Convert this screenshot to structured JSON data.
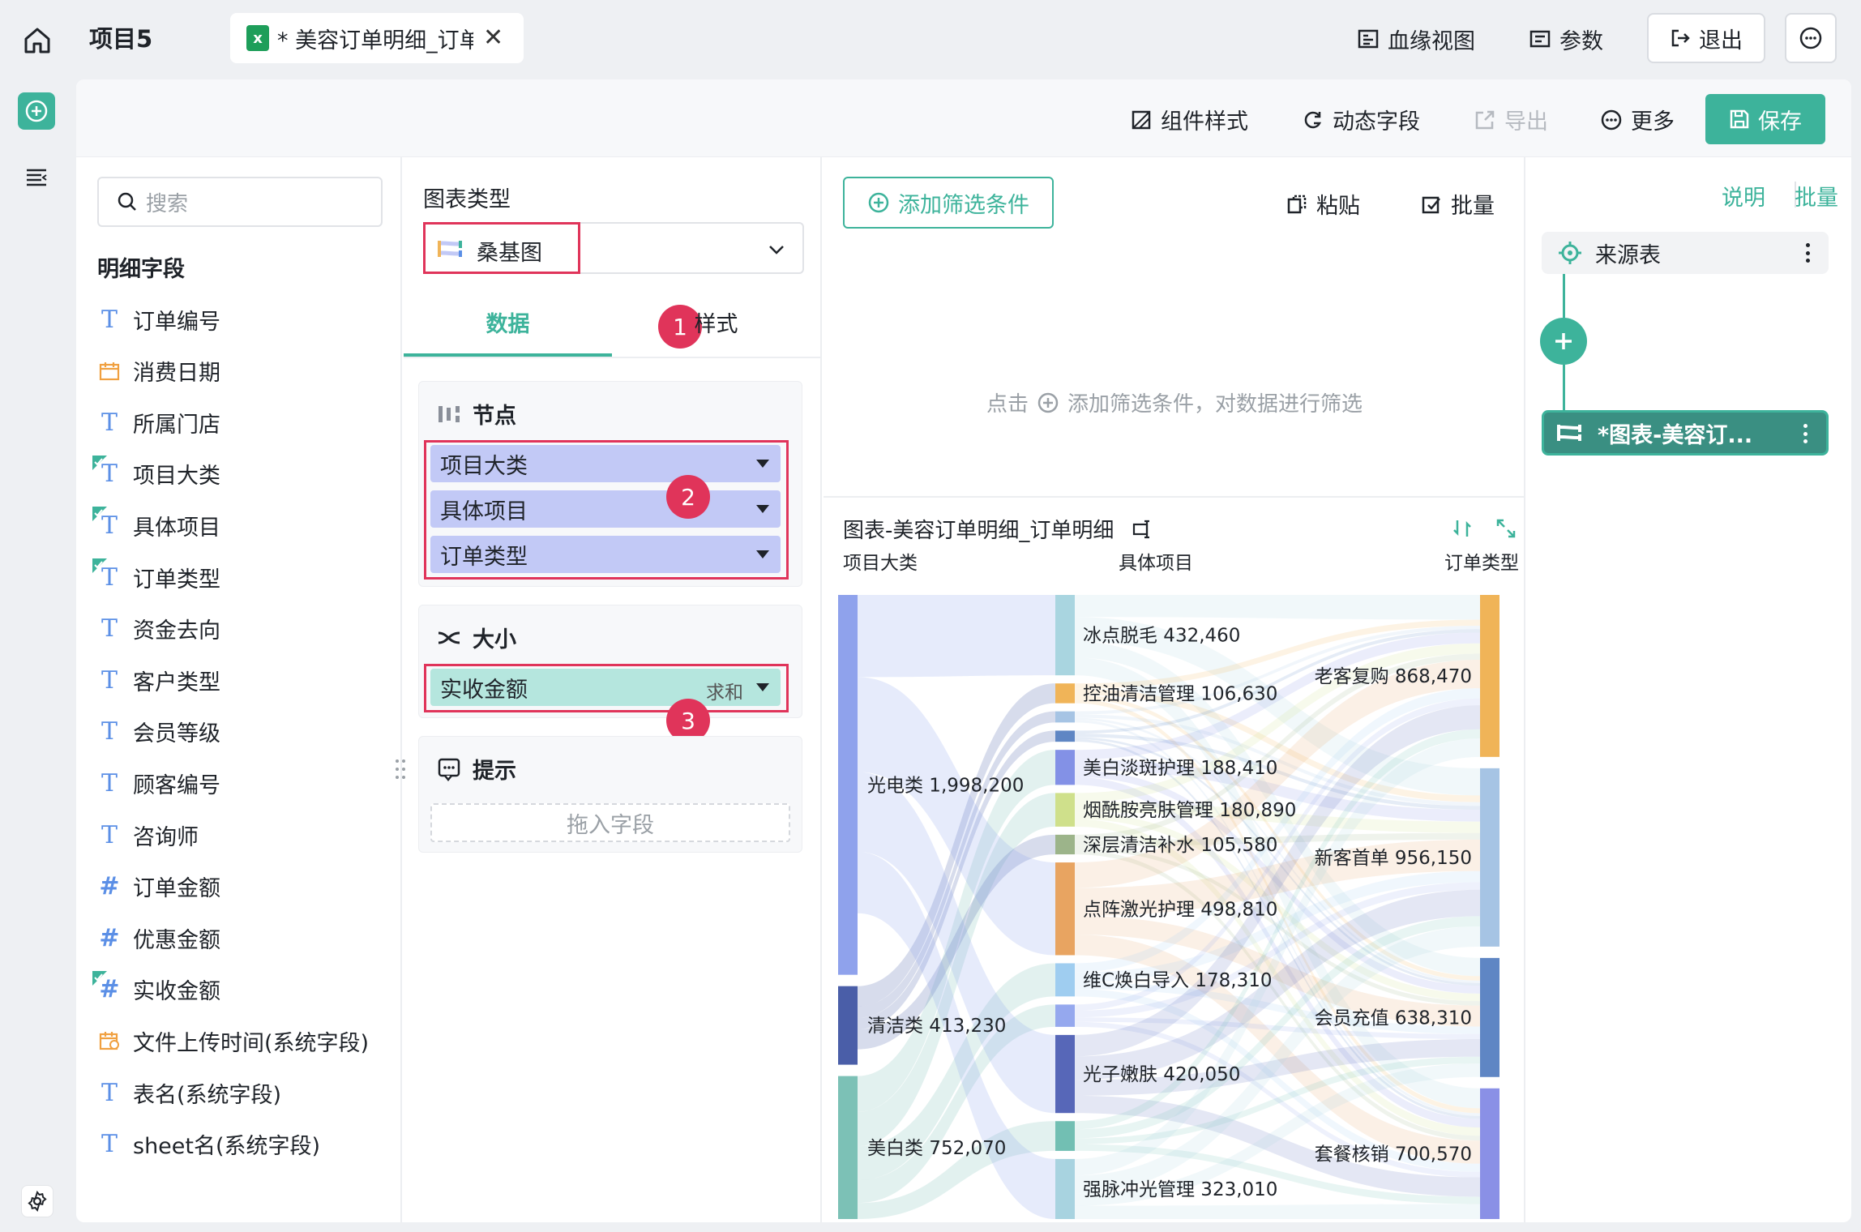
{
  "topbar": {
    "project_title": "项目5",
    "tab_label": "* 美容订单明细_订单明细",
    "lineage_label": "血缘视图",
    "params_label": "参数",
    "exit_label": "退出"
  },
  "toolbar": {
    "component_style": "组件样式",
    "dynamic_field": "动态字段",
    "export": "导出",
    "more": "更多",
    "save": "保存"
  },
  "fields_panel": {
    "search_placeholder": "搜索",
    "section_title": "明细字段",
    "fields": [
      {
        "label": "订单编号",
        "type": "text",
        "checked": false
      },
      {
        "label": "消费日期",
        "type": "date",
        "checked": false
      },
      {
        "label": "所属门店",
        "type": "text",
        "checked": false
      },
      {
        "label": "项目大类",
        "type": "text",
        "checked": true
      },
      {
        "label": "具体项目",
        "type": "text",
        "checked": true
      },
      {
        "label": "订单类型",
        "type": "text",
        "checked": true
      },
      {
        "label": "资金去向",
        "type": "text",
        "checked": false
      },
      {
        "label": "客户类型",
        "type": "text",
        "checked": false
      },
      {
        "label": "会员等级",
        "type": "text",
        "checked": false
      },
      {
        "label": "顾客编号",
        "type": "text",
        "checked": false
      },
      {
        "label": "咨询师",
        "type": "text",
        "checked": false
      },
      {
        "label": "订单金额",
        "type": "number",
        "checked": false
      },
      {
        "label": "优惠金额",
        "type": "number",
        "checked": false
      },
      {
        "label": "实收金额",
        "type": "number",
        "checked": true
      },
      {
        "label": "文件上传时间(系统字段)",
        "type": "datetime",
        "checked": false
      },
      {
        "label": "表名(系统字段)",
        "type": "text",
        "checked": false
      },
      {
        "label": "sheet名(系统字段)",
        "type": "text",
        "checked": false
      }
    ]
  },
  "config_panel": {
    "chart_type_label": "图表类型",
    "chart_type_value": "桑基图",
    "tab_data": "数据",
    "tab_style": "样式",
    "node_title": "节点",
    "node_fields": [
      "项目大类",
      "具体项目",
      "订单类型"
    ],
    "size_title": "大小",
    "size_field": "实收金额",
    "size_agg": "求和",
    "tooltip_title": "提示",
    "drop_placeholder": "拖入字段",
    "badges": [
      "1",
      "2",
      "3"
    ]
  },
  "preview_panel": {
    "add_filter": "添加筛选条件",
    "paste": "粘贴",
    "batch": "批量",
    "hint_prefix": "点击",
    "hint_suffix": "添加筛选条件，对数据进行筛选",
    "chart_title": "图表-美容订单明细_订单明细"
  },
  "chart_data": {
    "type": "sankey",
    "columns": [
      "项目大类",
      "具体项目",
      "订单类型"
    ],
    "categories": [
      {
        "name": "光电类",
        "value": 1998200,
        "label": "光电类 1,998,200",
        "color": "#8fa2ec"
      },
      {
        "name": "清洁类",
        "value": 413230,
        "label": "清洁类 413,230",
        "color": "#4a5ea8"
      },
      {
        "name": "美白类",
        "value": 752070,
        "label": "美白类 752,070",
        "color": "#7cc1b6"
      }
    ],
    "items": [
      {
        "name": "冰点脱毛",
        "value": 432460,
        "label": "冰点脱毛 432,460",
        "color": "#a9d5e0",
        "cat": 0
      },
      {
        "name": "控油清洁管理",
        "value": 106630,
        "label": "控油清洁管理 106,630",
        "color": "#f0b458",
        "cat": 1
      },
      {
        "name": "",
        "value": 60000,
        "label": "",
        "color": "#a6c4e4",
        "cat": 1
      },
      {
        "name": "",
        "value": 60000,
        "label": "",
        "color": "#5f86c4",
        "cat": 1
      },
      {
        "name": "美白淡斑护理",
        "value": 188410,
        "label": "美白淡斑护理 188,410",
        "color": "#8391e6",
        "cat": 2
      },
      {
        "name": "烟酰胺亮肤管理",
        "value": 180890,
        "label": "烟酰胺亮肤管理 180,890",
        "color": "#cfe08b",
        "cat": 2
      },
      {
        "name": "深层清洁补水",
        "value": 105580,
        "label": "深层清洁补水 105,580",
        "color": "#9cb48a",
        "cat": 1
      },
      {
        "name": "点阵激光护理",
        "value": 498810,
        "label": "点阵激光护理 498,810",
        "color": "#e8a461",
        "cat": 0
      },
      {
        "name": "维C焕白导入",
        "value": 178310,
        "label": "维C焕白导入 178,310",
        "color": "#9fcdf0",
        "cat": 2
      },
      {
        "name": "",
        "value": 120000,
        "label": "",
        "color": "#95a8ee",
        "cat": 2
      },
      {
        "name": "光子嫩肤",
        "value": 420050,
        "label": "光子嫩肤 420,050",
        "color": "#5767b8",
        "cat": 0
      },
      {
        "name": "",
        "value": 160000,
        "label": "",
        "color": "#72bfb3",
        "cat": 2
      },
      {
        "name": "强脉冲光管理",
        "value": 323010,
        "label": "强脉冲光管理 323,010",
        "color": "#a8d3e0",
        "cat": 0
      }
    ],
    "order_types": [
      {
        "name": "老客复购",
        "value": 868470,
        "label": "老客复购 868,470",
        "color": "#f0b458"
      },
      {
        "name": "新客首单",
        "value": 956150,
        "label": "新客首单 956,150",
        "color": "#a6c4e4"
      },
      {
        "name": "会员充值",
        "value": 638310,
        "label": "会员充值 638,310",
        "color": "#5f86c4"
      },
      {
        "name": "套餐核销",
        "value": 700570,
        "label": "套餐核销 700,570",
        "color": "#8a90e6"
      }
    ]
  },
  "lineage_panel": {
    "explain": "说明",
    "batch": "批量",
    "source_node": "来源表",
    "target_node": "*图表-美容订..."
  }
}
